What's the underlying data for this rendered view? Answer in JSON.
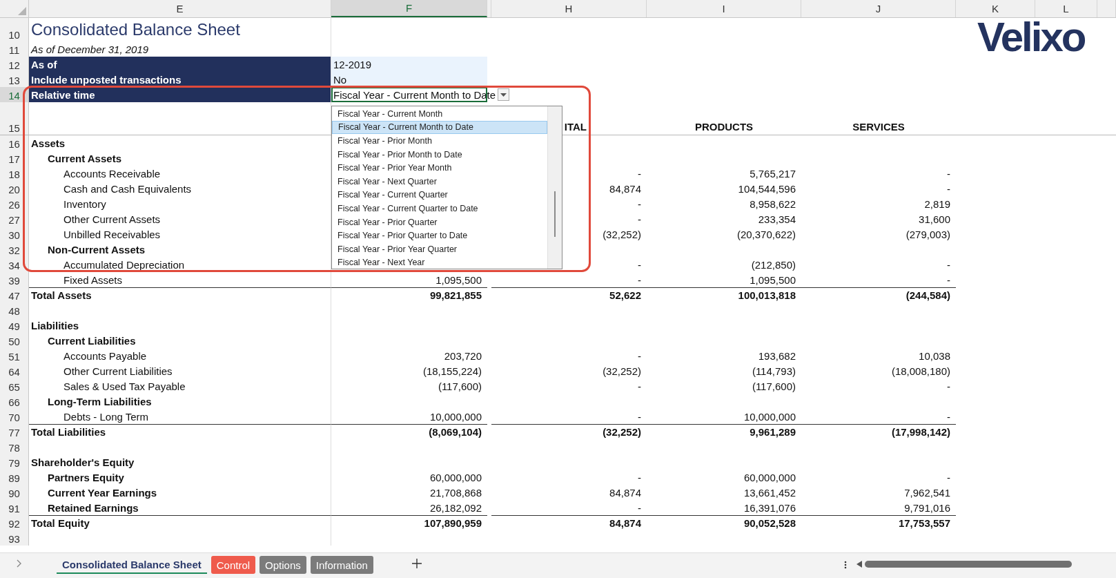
{
  "columns": [
    {
      "label": "E",
      "selected": false
    },
    {
      "label": "F",
      "selected": true
    },
    {
      "selected": false
    },
    {
      "label": "H",
      "selected": false
    },
    {
      "label": "I",
      "selected": false
    },
    {
      "label": "J",
      "selected": false
    },
    {
      "label": "K",
      "selected": false
    },
    {
      "label": "L",
      "selected": false
    }
  ],
  "logo": "Velixo",
  "rows": [
    {
      "row": "10",
      "kind": "title",
      "selected": false,
      "label": "Consolidated Balance Sheet"
    },
    {
      "row": "11",
      "kind": "subtitle",
      "selected": false,
      "label": "As of December 31, 2019"
    },
    {
      "row": "12",
      "kind": "param",
      "selected": false,
      "label": "As of",
      "value": "12-2019",
      "dropdown": false
    },
    {
      "row": "13",
      "kind": "param",
      "selected": false,
      "label": "Include unposted transactions",
      "value": "No",
      "dropdown": false
    },
    {
      "row": "14",
      "kind": "param",
      "selected": true,
      "label": "Relative time",
      "value": "Fiscal Year - Current Month to Date",
      "dropdown": true
    },
    {
      "row": "15",
      "kind": "header",
      "selected": false,
      "h": "ITAL",
      "i": "PRODUCTS",
      "j": "SERVICES"
    },
    {
      "row": "16",
      "kind": "section",
      "selected": false,
      "label": "Assets"
    },
    {
      "row": "17",
      "kind": "group",
      "selected": false,
      "label": "Current Assets"
    },
    {
      "row": "18",
      "kind": "item",
      "selected": false,
      "label": "Accounts Receivable",
      "h": "-",
      "i": "5,765,217",
      "j": "-"
    },
    {
      "row": "20",
      "kind": "item",
      "selected": false,
      "label": "Cash and Cash Equivalents",
      "h": "84,874",
      "i": "104,544,596",
      "j": "-"
    },
    {
      "row": "26",
      "kind": "item",
      "selected": false,
      "label": "Inventory",
      "h": "-",
      "i": "8,958,622",
      "j": "2,819"
    },
    {
      "row": "27",
      "kind": "item",
      "selected": false,
      "label": "Other Current Assets",
      "h": "-",
      "i": "233,354",
      "j": "31,600"
    },
    {
      "row": "30",
      "kind": "item",
      "selected": false,
      "label": "Unbilled Receivables",
      "h": "(32,252)",
      "i": "(20,370,622)",
      "j": "(279,003)"
    },
    {
      "row": "32",
      "kind": "group",
      "selected": false,
      "label": "Non-Current Assets"
    },
    {
      "row": "34",
      "kind": "item",
      "selected": false,
      "label": "Accumulated Depreciation",
      "h": "-",
      "i": "(212,850)",
      "j": "-"
    },
    {
      "row": "39",
      "kind": "item",
      "selected": false,
      "label": "Fixed Assets",
      "f": "1,095,500",
      "h": "-",
      "i": "1,095,500",
      "j": "-"
    },
    {
      "row": "47",
      "kind": "total",
      "selected": false,
      "label": "Total Assets",
      "f": "99,821,855",
      "h": "52,622",
      "i": "100,013,818",
      "j": "(244,584)"
    },
    {
      "row": "48",
      "kind": "blank",
      "selected": false
    },
    {
      "row": "49",
      "kind": "section",
      "selected": false,
      "label": "Liabilities"
    },
    {
      "row": "50",
      "kind": "group",
      "selected": false,
      "label": "Current Liabilities"
    },
    {
      "row": "51",
      "kind": "item",
      "selected": false,
      "label": "Accounts Payable",
      "f": "203,720",
      "h": "-",
      "i": "193,682",
      "j": "10,038"
    },
    {
      "row": "64",
      "kind": "item",
      "selected": false,
      "label": "Other Current Liabilities",
      "f": "(18,155,224)",
      "h": "(32,252)",
      "i": "(114,793)",
      "j": "(18,008,180)"
    },
    {
      "row": "65",
      "kind": "item",
      "selected": false,
      "label": "Sales & Used Tax Payable",
      "f": "(117,600)",
      "h": "-",
      "i": "(117,600)",
      "j": "-"
    },
    {
      "row": "66",
      "kind": "group",
      "selected": false,
      "label": "Long-Term Liabilities"
    },
    {
      "row": "70",
      "kind": "item",
      "selected": false,
      "label": "Debts - Long Term",
      "f": "10,000,000",
      "h": "-",
      "i": "10,000,000",
      "j": "-"
    },
    {
      "row": "77",
      "kind": "total",
      "selected": false,
      "label": "Total Liabilities",
      "f": "(8,069,104)",
      "h": "(32,252)",
      "i": "9,961,289",
      "j": "(17,998,142)"
    },
    {
      "row": "78",
      "kind": "blank",
      "selected": false
    },
    {
      "row": "79",
      "kind": "section",
      "selected": false,
      "label": "Shareholder's Equity"
    },
    {
      "row": "89",
      "kind": "group",
      "selected": false,
      "label": "Partners Equity",
      "f": "60,000,000",
      "h": "-",
      "i": "60,000,000",
      "j": "-"
    },
    {
      "row": "90",
      "kind": "group",
      "selected": false,
      "label": "Current Year Earnings",
      "f": "21,708,868",
      "h": "84,874",
      "i": "13,661,452",
      "j": "7,962,541"
    },
    {
      "row": "91",
      "kind": "group",
      "selected": false,
      "label": "Retained Earnings",
      "f": "26,182,092",
      "h": "-",
      "i": "16,391,076",
      "j": "9,791,016"
    },
    {
      "row": "92",
      "kind": "total",
      "selected": false,
      "label": "Total Equity",
      "f": "107,890,959",
      "h": "84,874",
      "i": "90,052,528",
      "j": "17,753,557"
    },
    {
      "row": "93",
      "kind": "blank",
      "selected": false
    }
  ],
  "dropdown_list": {
    "options": [
      {
        "label": "Fiscal Year - Current Month",
        "selected": false
      },
      {
        "label": "Fiscal Year - Current Month to Date",
        "selected": true
      },
      {
        "label": "Fiscal Year - Prior Month",
        "selected": false
      },
      {
        "label": "Fiscal Year - Prior Month to Date",
        "selected": false
      },
      {
        "label": "Fiscal Year - Prior Year Month",
        "selected": false
      },
      {
        "label": "Fiscal Year - Next Quarter",
        "selected": false
      },
      {
        "label": "Fiscal Year - Current Quarter",
        "selected": false
      },
      {
        "label": "Fiscal Year - Current Quarter to Date",
        "selected": false
      },
      {
        "label": "Fiscal Year - Prior Quarter",
        "selected": false
      },
      {
        "label": "Fiscal Year - Prior Quarter to Date",
        "selected": false
      },
      {
        "label": "Fiscal Year - Prior Year Quarter",
        "selected": false
      },
      {
        "label": "Fiscal Year - Next Year",
        "selected": false
      }
    ]
  },
  "sheet_tabs": [
    {
      "label": "Consolidated Balance Sheet",
      "selected": true,
      "color": "#f3f3f3"
    },
    {
      "label": "Control",
      "selected": false,
      "color": "#ef5b4c"
    },
    {
      "label": "Options",
      "selected": false,
      "color": "#7b7b7b"
    },
    {
      "label": "Information",
      "selected": false,
      "color": "#7b7b7b"
    }
  ]
}
